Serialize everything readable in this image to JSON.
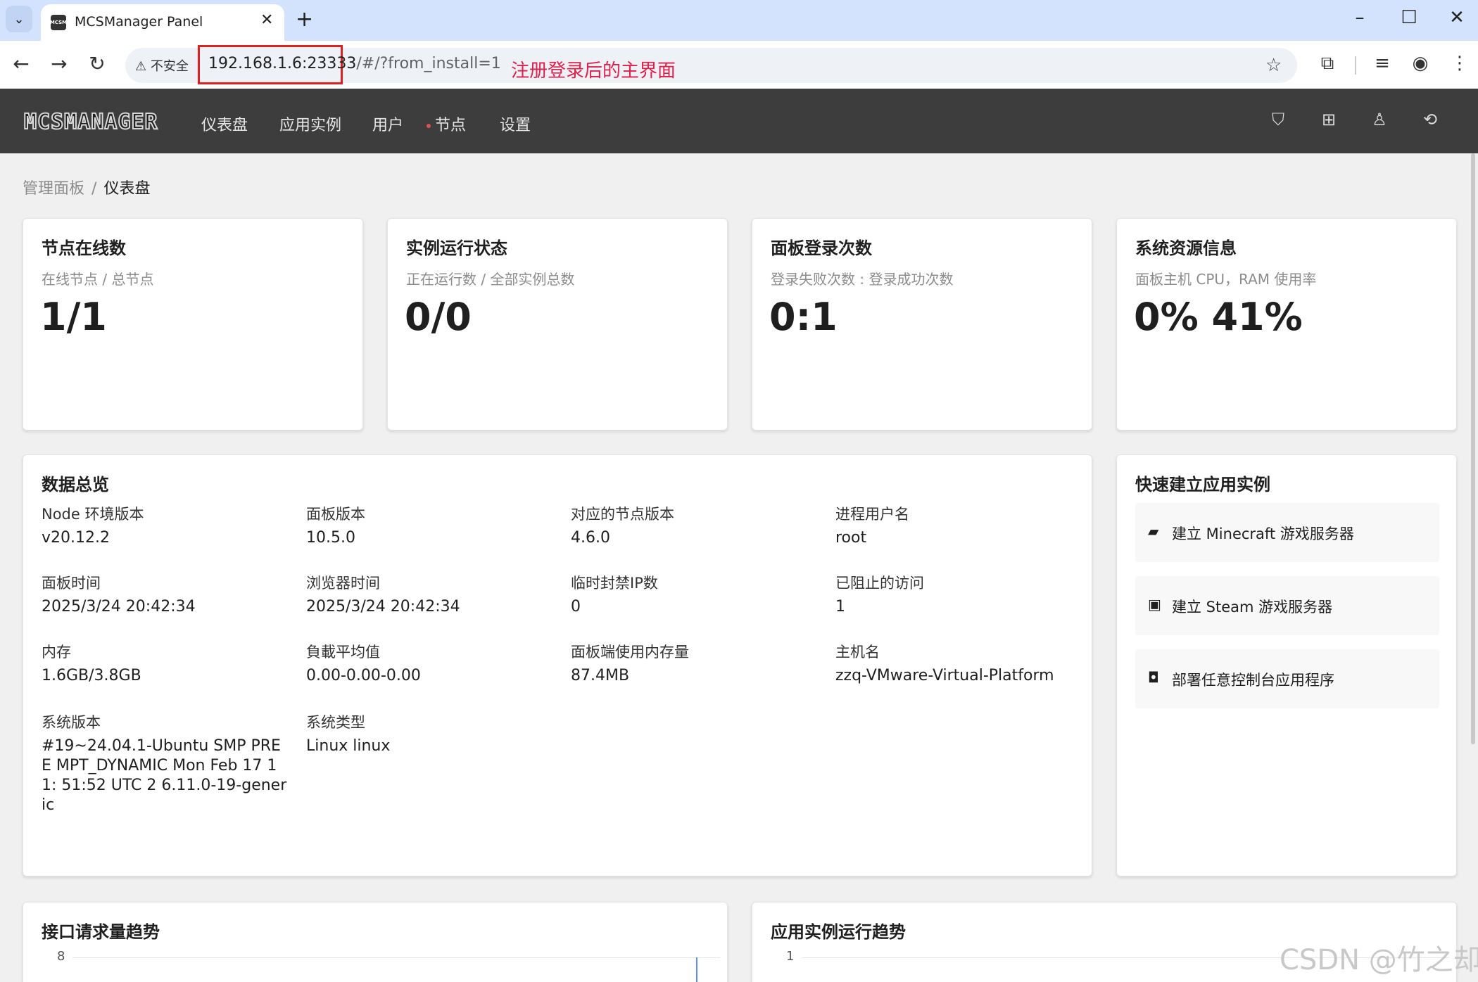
{
  "browser": {
    "tab_title": "MCSManager Panel",
    "tab_favicon_text": "MCSM",
    "security_label": "不安全",
    "url_host": "192.168.1.6:23333",
    "url_rest": "/#/?from_install=1",
    "annotation": "注册登录后的主界面"
  },
  "header": {
    "logo": "MCSMANAGER",
    "menu": [
      "仪表盘",
      "应用实例",
      "用户",
      "节点",
      "设置"
    ]
  },
  "breadcrumb": {
    "parent": "管理面板",
    "separator": "/",
    "current": "仪表盘"
  },
  "stats": [
    {
      "title": "节点在线数",
      "subtitle": "在线节点 / 总节点",
      "value": "1/1"
    },
    {
      "title": "实例运行状态",
      "subtitle": "正在运行数 / 全部实例总数",
      "value": "0/0"
    },
    {
      "title": "面板登录次数",
      "subtitle": "登录失败次数 : 登录成功次数",
      "value": "0:1"
    },
    {
      "title": "系统资源信息",
      "subtitle": "面板主机 CPU，RAM 使用率",
      "value": "0% 41%"
    }
  ],
  "overview": {
    "title": "数据总览",
    "items": [
      {
        "label": "Node 环境版本",
        "value": "v20.12.2"
      },
      {
        "label": "面板版本",
        "value": "10.5.0"
      },
      {
        "label": "对应的节点版本",
        "value": "4.6.0"
      },
      {
        "label": "进程用户名",
        "value": "root"
      },
      {
        "label": "面板时间",
        "value": "2025/3/24 20:42:34"
      },
      {
        "label": "浏览器时间",
        "value": "2025/3/24 20:42:34"
      },
      {
        "label": "临时封禁IP数",
        "value": "0"
      },
      {
        "label": "已阻止的访问",
        "value": "1"
      },
      {
        "label": "内存",
        "value": "1.6GB/3.8GB"
      },
      {
        "label": "負載平均值",
        "value": "0.00-0.00-0.00"
      },
      {
        "label": "面板端使用内存量",
        "value": "87.4MB"
      },
      {
        "label": "主机名",
        "value": "zzq-VMware-Virtual-Platform"
      },
      {
        "label": "系统版本",
        "value": "#19~24.04.1-Ubuntu SMP PREE MPT_DYNAMIC Mon Feb 17 11: 51:52 UTC 2 6.11.0-19-generic"
      },
      {
        "label": "系统类型",
        "value": "Linux linux"
      }
    ]
  },
  "quick_actions": {
    "title": "快速建立应用实例",
    "items": [
      {
        "icon": "cube-icon",
        "label": "建立 Minecraft 游戏服务器"
      },
      {
        "icon": "steam-box-icon",
        "label": "建立 Steam 游戏服务器"
      },
      {
        "icon": "deploy-icon",
        "label": "部署任意控制台应用程序"
      }
    ]
  },
  "charts": {
    "api_title": "接口请求量趋势",
    "api_tick_top": "8",
    "instance_title": "应用实例运行趋势",
    "instance_tick_top": "1"
  },
  "watermark": "CSDN @竹之却",
  "colors": {
    "header_bg": "#3d3d3d",
    "page_bg": "#f0f0f0",
    "annotation": "#e0204a",
    "tab_strip": "#d3e3fd"
  }
}
